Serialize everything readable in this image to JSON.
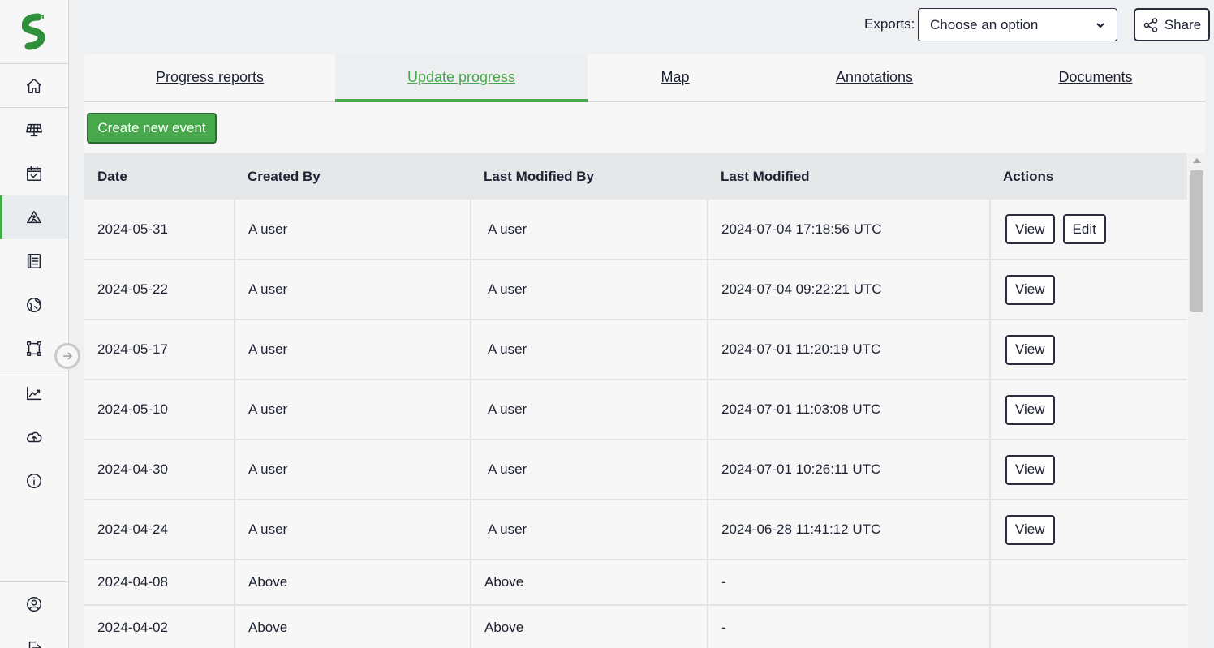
{
  "header": {
    "exports_label": "Exports:",
    "exports_select_value": "Choose an option",
    "share_label": "Share"
  },
  "tabs": [
    {
      "label": "Progress reports"
    },
    {
      "label": "Update progress"
    },
    {
      "label": "Map"
    },
    {
      "label": "Annotations"
    },
    {
      "label": "Documents"
    }
  ],
  "create_button": "Create new event",
  "table": {
    "headers": [
      "Date",
      "Created By",
      "Last Modified By",
      "Last Modified",
      "Actions"
    ],
    "rows": [
      {
        "date": "2024-05-31",
        "created_by": "A user",
        "modified_by": "A user",
        "modified": "2024-07-04 17:18:56 UTC",
        "view": "View",
        "edit": "Edit"
      },
      {
        "date": "2024-05-22",
        "created_by": "A user",
        "modified_by": "A user",
        "modified": "2024-07-04 09:22:21 UTC",
        "view": "View"
      },
      {
        "date": "2024-05-17",
        "created_by": "A user",
        "modified_by": "A user",
        "modified": "2024-07-01 11:20:19 UTC",
        "view": "View"
      },
      {
        "date": "2024-05-10",
        "created_by": "A user",
        "modified_by": "A user",
        "modified": "2024-07-01 11:03:08 UTC",
        "view": "View"
      },
      {
        "date": "2024-04-30",
        "created_by": "A user",
        "modified_by": "A user",
        "modified": "2024-07-01 10:26:11 UTC",
        "view": "View"
      },
      {
        "date": "2024-04-24",
        "created_by": "A user",
        "modified_by": "A user",
        "modified": "2024-06-28 11:41:12 UTC",
        "view": "View"
      },
      {
        "date": "2024-04-08",
        "created_by": "Above",
        "modified_by": "Above",
        "modified": "-"
      },
      {
        "date": "2024-04-02",
        "created_by": "Above",
        "modified_by": "Above",
        "modified": "-"
      }
    ]
  },
  "colors": {
    "accent": "#48a84c",
    "text": "#1e2233"
  },
  "sidebar_icons": [
    "home-icon",
    "solar-panel-icon",
    "calendar-check-icon",
    "construction-progress-icon",
    "report-list-icon",
    "globe-icon",
    "bounding-box-icon",
    "trend-chart-icon",
    "cloud-upload-icon",
    "info-icon",
    "user-circle-icon",
    "logout-icon"
  ]
}
